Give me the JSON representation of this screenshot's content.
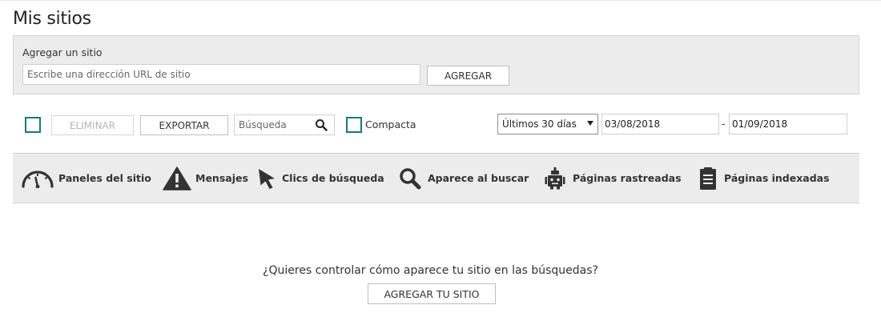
{
  "page": {
    "title": "Mis sitios"
  },
  "add_site": {
    "label": "Agregar un sitio",
    "url_placeholder": "Escribe una dirección URL de sitio",
    "url_value": "",
    "add_button": "AGREGAR"
  },
  "toolbar": {
    "delete_button": "ELIMINAR",
    "export_button": "EXPORTAR",
    "search_placeholder": "Búsqueda",
    "compact_label": "Compacta",
    "date_range": "Últimos 30 días",
    "date_from": "03/08/2018",
    "date_separator": "-",
    "date_to": "01/09/2018"
  },
  "tabs": [
    {
      "label": "Paneles del sitio",
      "icon": "gauge-icon"
    },
    {
      "label": "Mensajes",
      "icon": "warning-icon"
    },
    {
      "label": "Clics de búsqueda",
      "icon": "cursor-icon"
    },
    {
      "label": "Aparece al buscar",
      "icon": "magnifier-icon"
    },
    {
      "label": "Páginas rastreadas",
      "icon": "robot-icon"
    },
    {
      "label": "Páginas indexadas",
      "icon": "document-icon"
    }
  ],
  "empty_state": {
    "message": "¿Quieres controlar cómo aparece tu sitio en las búsquedas?",
    "button": "AGREGAR TU SITIO"
  },
  "colors": {
    "accent": "#167a80",
    "panel_bg": "#ececec",
    "border": "#cfcfcf"
  }
}
